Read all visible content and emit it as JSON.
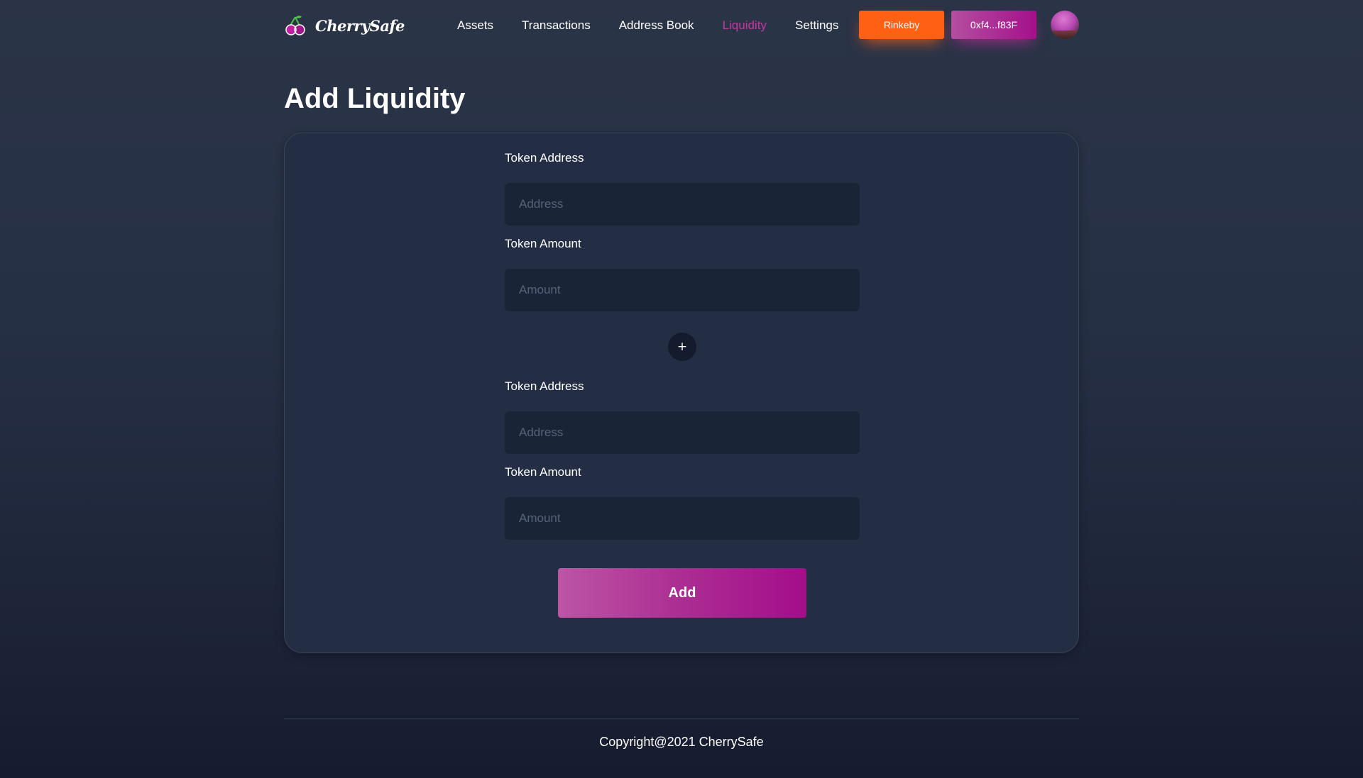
{
  "header": {
    "brand_name": "CherrySafe",
    "brand_icon": "cherry-logo-icon",
    "nav": [
      {
        "label": "Assets",
        "active": false
      },
      {
        "label": "Transactions",
        "active": false
      },
      {
        "label": "Address Book",
        "active": false
      },
      {
        "label": "Liquidity",
        "active": true
      },
      {
        "label": "Settings",
        "active": false
      }
    ],
    "network_button": "Rinkeby",
    "wallet_button": "0xf4...f83F",
    "avatar_icon": "user-avatar"
  },
  "page": {
    "title": "Add Liquidity"
  },
  "form": {
    "token_a": {
      "address_label": "Token Address",
      "address_placeholder": "Address",
      "address_value": "",
      "amount_label": "Token Amount",
      "amount_placeholder": "Amount",
      "amount_value": ""
    },
    "plus_label": "+",
    "token_b": {
      "address_label": "Token Address",
      "address_placeholder": "Address",
      "address_value": "",
      "amount_label": "Token Amount",
      "amount_placeholder": "Amount",
      "amount_value": ""
    },
    "submit_label": "Add"
  },
  "footer": {
    "copyright": "Copyright@2021 CherrySafe"
  },
  "colors": {
    "accent": "#c23aa0",
    "network": "#ff6114",
    "wallet_gradient_start": "#b44ea0",
    "wallet_gradient_end": "#a4108a",
    "card_bg": "#232e45",
    "input_bg": "#1a2437"
  }
}
